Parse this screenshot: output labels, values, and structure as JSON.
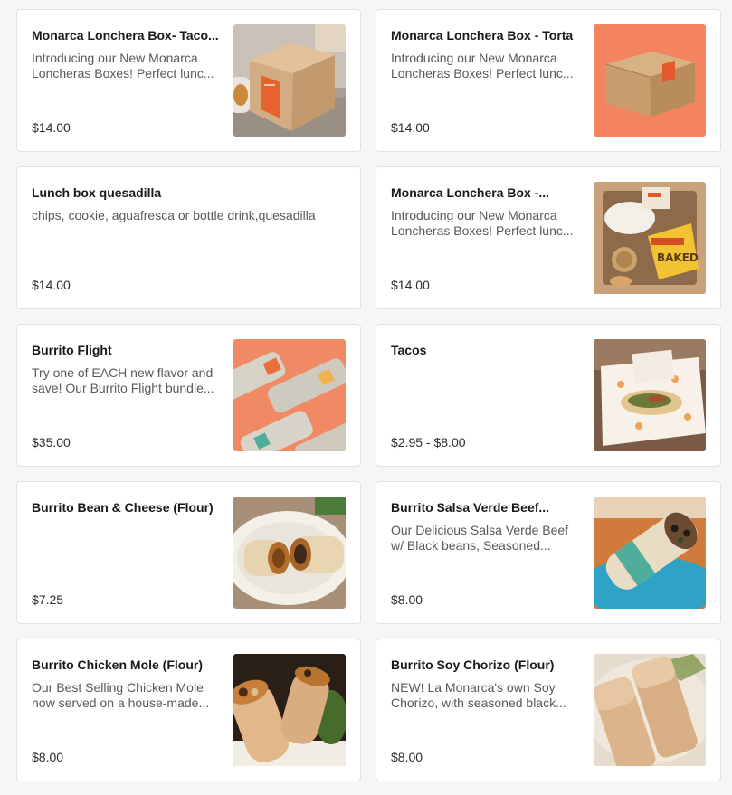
{
  "menu_items": [
    {
      "name": "Monarca Lonchera Box- Taco...",
      "description": "Introducing our New Monarca Loncheras Boxes! Perfect lunc...",
      "price": "$14.00",
      "image": "lonchera-box-taco-photo"
    },
    {
      "name": "Monarca Lonchera Box - Torta",
      "description": "Introducing our New Monarca Loncheras Boxes! Perfect lunc...",
      "price": "$14.00",
      "image": "lonchera-box-torta-photo"
    },
    {
      "name": "Lunch box quesadilla",
      "description": "chips, cookie, aguafresca or bottle drink,quesadilla",
      "price": "$14.00",
      "image": ""
    },
    {
      "name": "Monarca Lonchera Box -...",
      "description": "Introducing our New Monarca Loncheras Boxes! Perfect lunc...",
      "price": "$14.00",
      "image": "lonchera-box-open-photo"
    },
    {
      "name": "Burrito Flight",
      "description": "Try one of EACH new flavor and save! Our Burrito Flight bundle...",
      "price": "$35.00",
      "image": "burrito-flight-photo"
    },
    {
      "name": "Tacos",
      "description": "",
      "price": "$2.95 - $8.00",
      "image": "tacos-photo"
    },
    {
      "name": "Burrito Bean & Cheese (Flour)",
      "description": "",
      "price": "$7.25",
      "image": "bean-cheese-burrito-photo"
    },
    {
      "name": "Burrito Salsa Verde Beef...",
      "description": "Our Delicious Salsa Verde Beef w/ Black beans, Seasoned...",
      "price": "$8.00",
      "image": "salsa-verde-burrito-photo"
    },
    {
      "name": "Burrito Chicken Mole (Flour)",
      "description": "Our Best Selling Chicken Mole now served on a house-made...",
      "price": "$8.00",
      "image": "chicken-mole-burrito-photo"
    },
    {
      "name": "Burrito Soy Chorizo (Flour)",
      "description": "NEW! La Monarca's own Soy Chorizo, with seasoned black...",
      "price": "$8.00",
      "image": "soy-chorizo-burrito-photo"
    }
  ],
  "colors": {
    "page_background": "#f7f6f6",
    "card_background": "#ffffff",
    "card_border": "#e3e1e1",
    "brand_orange": "#f08a65"
  }
}
